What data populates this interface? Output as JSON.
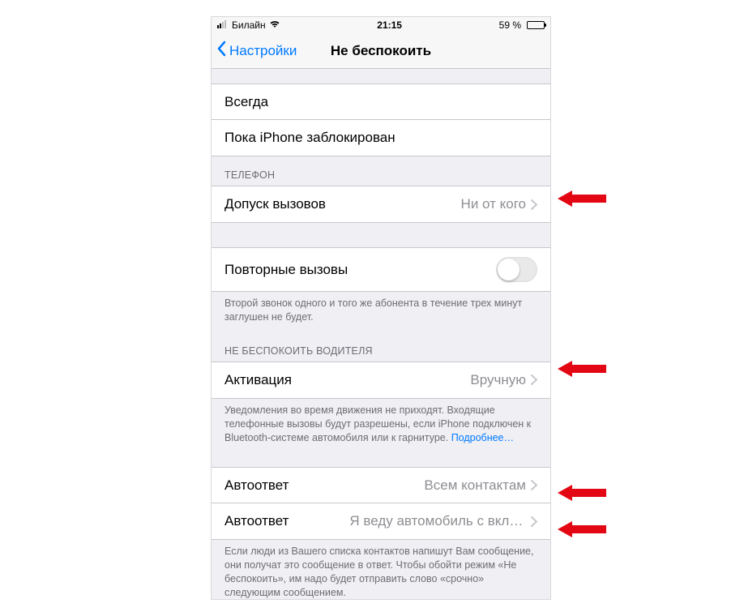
{
  "status": {
    "carrier": "Билайн",
    "time": "21:15",
    "battery_pct": "59 %"
  },
  "nav": {
    "back_label": "Настройки",
    "title": "Не беспокоить"
  },
  "silence_section": {
    "always": "Всегда",
    "while_locked": "Пока iPhone заблокирован"
  },
  "phone_section": {
    "header": "ТЕЛЕФОН",
    "allow_calls_label": "Допуск вызовов",
    "allow_calls_value": "Ни от кого"
  },
  "repeat_section": {
    "repeat_label": "Повторные вызовы",
    "repeat_footer": "Второй звонок одного и того же абонента в течение трех минут заглушен не будет."
  },
  "driving_section": {
    "header": "НЕ БЕСПОКОИТЬ ВОДИТЕЛЯ",
    "activate_label": "Активация",
    "activate_value": "Вручную",
    "activate_footer": "Уведомления во время движения не приходят. Входящие телефонные вызовы будут разрешены, если iPhone подключен к Bluetooth‑системе автомобиля или к гарнитуре.",
    "activate_footer_link": "Подробнее…"
  },
  "autoreply_section": {
    "autoreply_to_label": "Автоответ",
    "autoreply_to_value": "Всем контактам",
    "autoreply_msg_label": "Автоответ",
    "autoreply_msg_value": "Я веду автомобиль с включенн…",
    "autoreply_footer": "Если люди из Вашего списка контактов напишут Вам сообщение, они получат это сообщение в ответ. Чтобы обойти режим «Не беспокоить», им надо будет отправить слово «срочно» следующим сообщением."
  }
}
